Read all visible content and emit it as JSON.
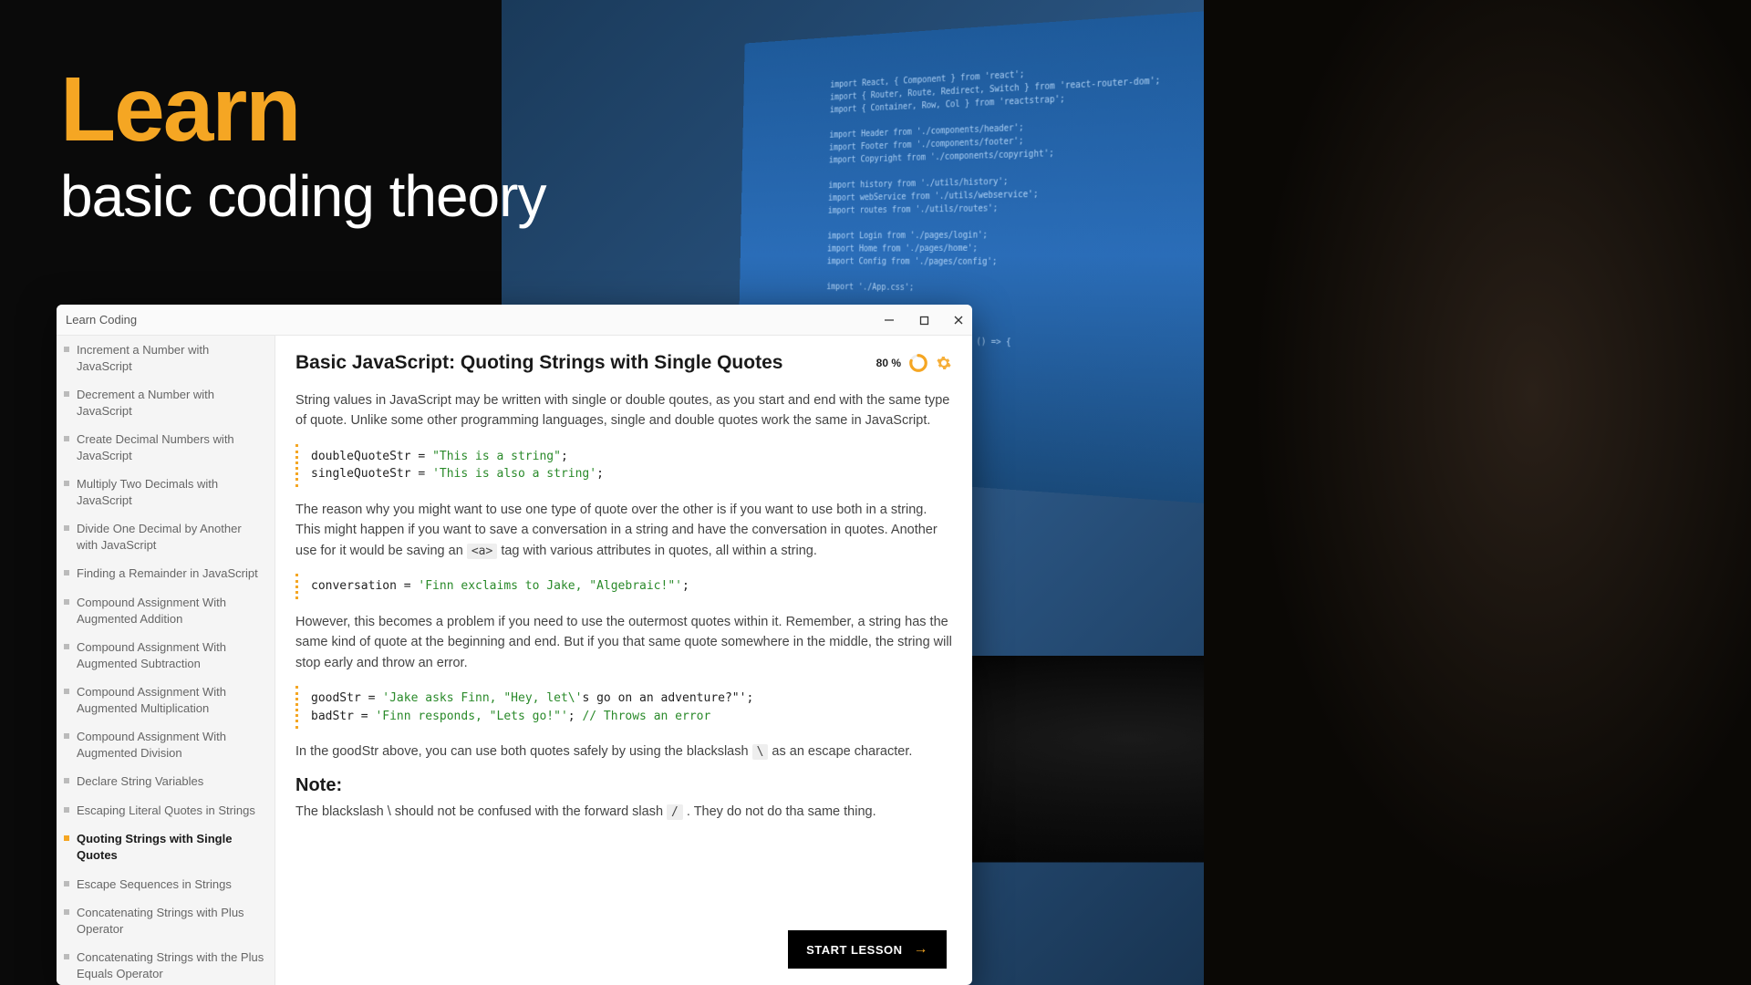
{
  "hero": {
    "learn": "Learn",
    "subtitle": "basic coding theory"
  },
  "window": {
    "title": "Learn Coding"
  },
  "progress": {
    "percent": "80 %"
  },
  "sidebar": {
    "items": [
      {
        "label": "Increment a Number with JavaScript",
        "active": false
      },
      {
        "label": "Decrement a Number with JavaScript",
        "active": false
      },
      {
        "label": "Create Decimal Numbers with JavaScript",
        "active": false
      },
      {
        "label": "Multiply Two Decimals with JavaScript",
        "active": false
      },
      {
        "label": "Divide One Decimal by Another with JavaScript",
        "active": false
      },
      {
        "label": "Finding a Remainder in JavaScript",
        "active": false
      },
      {
        "label": "Compound Assignment With Augmented Addition",
        "active": false
      },
      {
        "label": "Compound Assignment With Augmented Subtraction",
        "active": false
      },
      {
        "label": "Compound Assignment With Augmented Multiplication",
        "active": false
      },
      {
        "label": "Compound Assignment With Augmented Division",
        "active": false
      },
      {
        "label": "Declare String Variables",
        "active": false
      },
      {
        "label": "Escaping Literal Quotes in Strings",
        "active": false
      },
      {
        "label": "Quoting Strings with Single Quotes",
        "active": true
      },
      {
        "label": "Escape Sequences in Strings",
        "active": false
      },
      {
        "label": "Concatenating Strings with Plus Operator",
        "active": false
      },
      {
        "label": "Concatenating Strings with the Plus Equals Operator",
        "active": false
      }
    ]
  },
  "lesson": {
    "title": "Basic JavaScript: Quoting Strings with Single Quotes",
    "para1": "String values in JavaScript may be written with single or double qoutes, as you start and end with the same type of quote. Unlike some other programming languages, single and double quotes work the same in JavaScript.",
    "code1": {
      "l1_var": "doubleQuoteStr = ",
      "l1_str": "\"This is a string\"",
      "l1_end": ";",
      "l2_var": "singleQuoteStr = ",
      "l2_str": "'This is also a string'",
      "l2_end": ";"
    },
    "para2a": "The reason why you might want to use one type of quote over the other is if you want to use both in a string. This might happen if you want to save a conversation in a string and have the conversation in quotes. Another use for it would be saving an ",
    "para2_code": "<a>",
    "para2b": " tag with various attributes in quotes, all within a string.",
    "code2": {
      "var": "conversation = ",
      "str": "'Finn exclaims to Jake, \"Algebraic!\"'",
      "end": ";"
    },
    "para3": "However, this becomes a problem if you need to use the outermost quotes within it. Remember, a string has the same kind of quote at the beginning and end. But if you that same quote somewhere in the middle, the string will stop early and throw an error.",
    "code3": {
      "l1_var": "goodStr = ",
      "l1_str": "'Jake asks Finn, \"Hey, let\\'",
      "l1_rest": "s go on an adventure?\"';",
      "l2_var": "badStr = ",
      "l2_str": "'Finn responds, \"Lets go!\"'",
      "l2_end": "; ",
      "l2_comment": "// Throws an error"
    },
    "para4a": "In the goodStr above, you can use both quotes safely by using the blackslash ",
    "para4_code": "\\",
    "para4b": " as an escape character.",
    "note_heading": "Note:",
    "para5a": "The blackslash \\ should not be confused with the forward slash ",
    "para5_code": "/",
    "para5b": " . They do not do tha same thing.",
    "start_button": "START LESSON"
  }
}
